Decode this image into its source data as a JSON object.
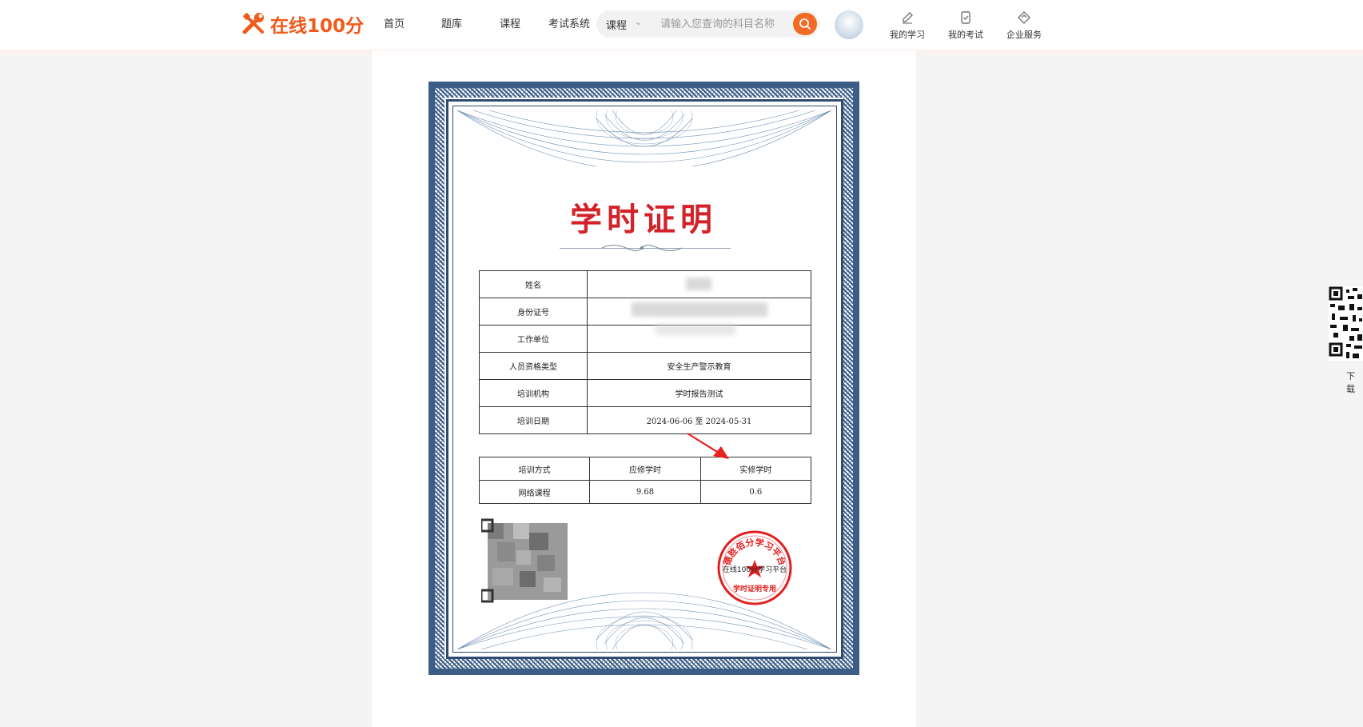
{
  "header": {
    "logo_text": "在线100分",
    "nav": [
      "首页",
      "题库",
      "课程",
      "考试系统"
    ],
    "search": {
      "category": "课程",
      "placeholder": "请输入您查询的科目名称"
    },
    "quick_links": [
      "我的学习",
      "我的考试",
      "企业服务"
    ]
  },
  "certificate": {
    "title": "学时证明",
    "info_rows": [
      {
        "label": "姓名",
        "value": ""
      },
      {
        "label": "身份证号",
        "value": ""
      },
      {
        "label": "工作单位",
        "value": ""
      },
      {
        "label": "人员资格类型",
        "value": "安全生产警示教育"
      },
      {
        "label": "培训机构",
        "value": "学时报告测试"
      },
      {
        "label": "培训日期",
        "value": "2024-06-06 至 2024-05-31"
      }
    ],
    "training_header": [
      "培训方式",
      "应修学时",
      "实修学时"
    ],
    "training_rows": [
      [
        "网络课程",
        "9.68",
        "0.6"
      ]
    ],
    "seal": {
      "ring_text": "德胜佰分学习平台",
      "center_text": "在线100分学习平台",
      "bottom_text": "学时证明专用"
    }
  },
  "sidebar": {
    "download_label": "下载"
  },
  "colors": {
    "brand": "#f05a1a",
    "seal_red": "#e02020",
    "border_blue": "#2e4b72"
  }
}
